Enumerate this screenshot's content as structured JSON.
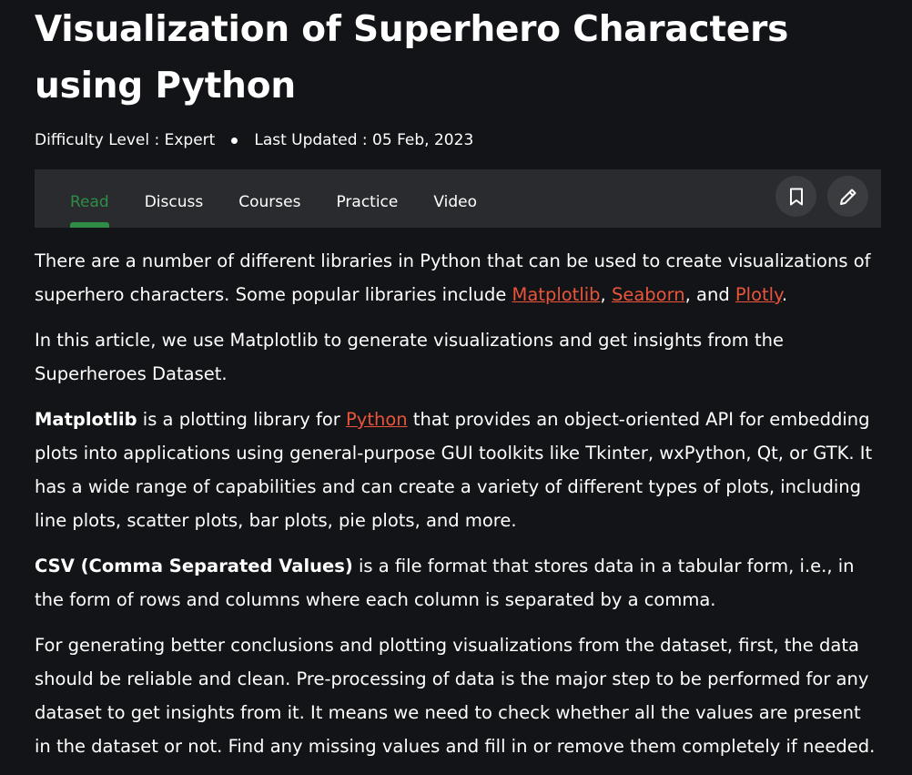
{
  "article": {
    "title": "Visualization of Superhero Characters using Python",
    "difficulty": "Difficulty Level : Expert",
    "last_updated": "Last Updated : 05 Feb, 2023"
  },
  "tabs": [
    {
      "label": "Read",
      "active": true
    },
    {
      "label": "Discuss",
      "active": false
    },
    {
      "label": "Courses",
      "active": false
    },
    {
      "label": "Practice",
      "active": false
    },
    {
      "label": "Video",
      "active": false
    }
  ],
  "actions": {
    "bookmark_icon": "bookmark-icon",
    "edit_icon": "pencil-icon"
  },
  "paragraphs": {
    "p1": {
      "text_a": "There are a number of different libraries in Python that can be used to create visualizations of superhero characters. Some popular libraries include ",
      "link_matplotlib": "Matplotlib",
      "sep1": ", ",
      "link_seaborn": "Seaborn",
      "sep2": ", and ",
      "link_plotly": "Plotly",
      "end": "."
    },
    "p2": "In this article, we use Matplotlib to generate visualizations and get insights from the Superheroes Dataset.",
    "p3": {
      "bold": "Matplotlib",
      "text_a": " is a plotting library for ",
      "link_python": "Python",
      "text_b": " that provides an object-oriented API for embedding plots into applications using general-purpose GUI toolkits like Tkinter, wxPython, Qt, or GTK. It has a wide range of capabilities and can create a variety of different types of plots, including line plots, scatter plots, bar plots, pie plots, and more."
    },
    "p4": {
      "bold": "CSV (Comma Separated Values)",
      "text": " is a file format that stores data in a tabular form, i.e., in the form of rows and columns where each column is separated by a comma."
    },
    "p5": "For generating better conclusions and plotting visualizations from the dataset, first, the data should be reliable and clean. Pre-processing of data is the major step to be performed for any dataset to get insights from it. It means we need to check whether all the values are present in the dataset or not. Find any missing values and fill in or remove them completely if needed."
  },
  "colors": {
    "background": "#131417",
    "tabbar": "#2a2b2e",
    "accent_green": "#2f8d46",
    "link": "#e9553a"
  }
}
